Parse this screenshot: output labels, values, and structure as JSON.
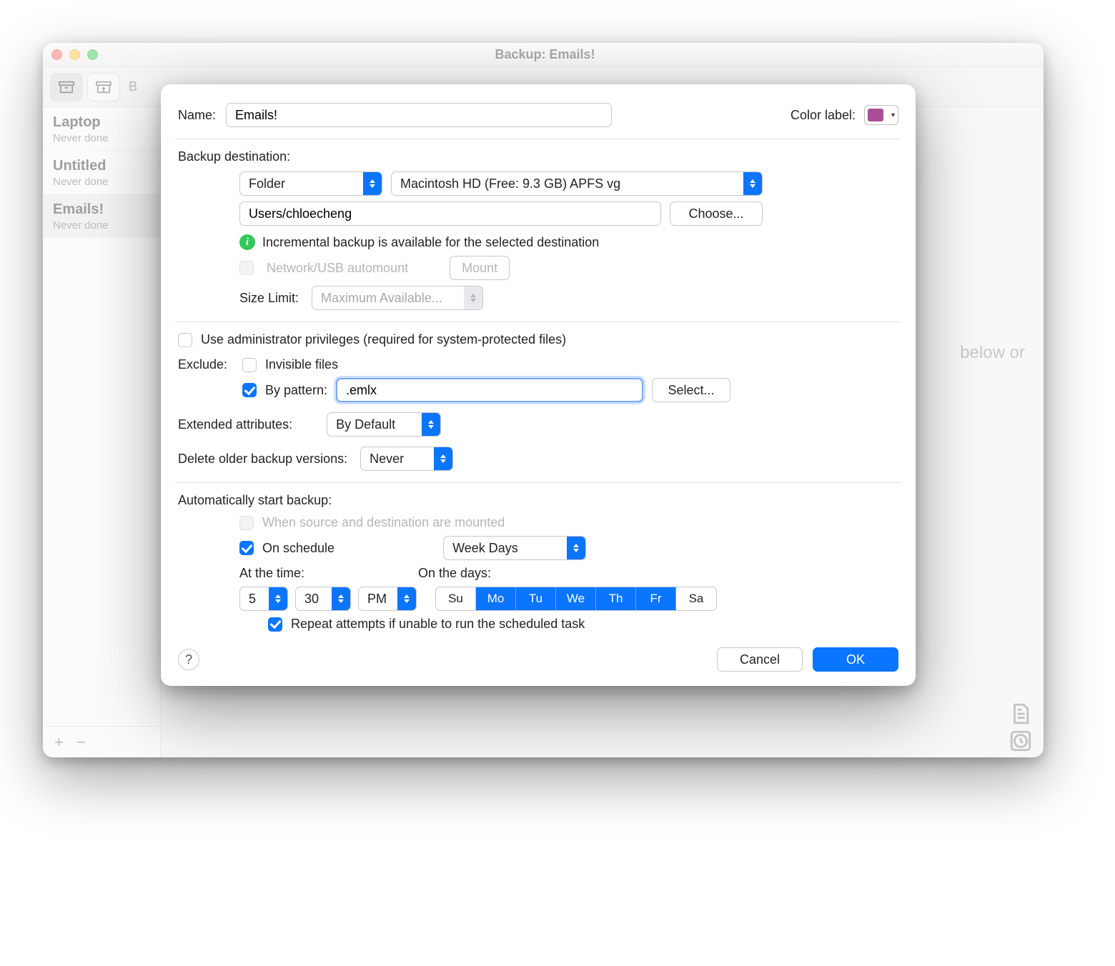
{
  "window": {
    "title": "Backup: Emails!"
  },
  "toolbar": {
    "tab_letter": "B"
  },
  "sidebar": {
    "items": [
      {
        "name": "Laptop",
        "sub": "Never done"
      },
      {
        "name": "Untitled",
        "sub": "Never done"
      },
      {
        "name": "Emails!",
        "sub": "Never done"
      }
    ],
    "add_label": "+",
    "remove_label": "−"
  },
  "bg_hint": "below or",
  "sheet": {
    "name_label": "Name:",
    "name_value": "Emails!",
    "color_label": "Color label:",
    "destination": {
      "header": "Backup destination:",
      "type": "Folder",
      "volume": "Macintosh HD (Free: 9.3 GB) APFS vg",
      "path": "Users/chloecheng",
      "choose": "Choose...",
      "info": "Incremental backup is available for the selected destination",
      "automount": "Network/USB automount",
      "mount": "Mount",
      "size_limit_label": "Size Limit:",
      "size_limit_value": "Maximum Available..."
    },
    "admin_priv": "Use administrator privileges (required for system-protected files)",
    "exclude": {
      "label": "Exclude:",
      "invisible": "Invisible files",
      "by_pattern_label": "By pattern:",
      "pattern_value": ".emlx",
      "select": "Select..."
    },
    "ext_attr": {
      "label": "Extended attributes:",
      "value": "By Default"
    },
    "delete_old": {
      "label": "Delete older backup versions:",
      "value": "Never"
    },
    "auto": {
      "header": "Automatically start backup:",
      "when_mounted": "When source and destination are mounted",
      "on_schedule": "On schedule",
      "schedule_type": "Week Days",
      "at_time_label": "At the time:",
      "hour": "5",
      "minute": "30",
      "ampm": "PM",
      "on_the_days_label": "On the days:",
      "days": [
        "Su",
        "Mo",
        "Tu",
        "We",
        "Th",
        "Fr",
        "Sa"
      ],
      "days_on": [
        false,
        true,
        true,
        true,
        true,
        true,
        false
      ],
      "repeat": "Repeat attempts if unable to run the scheduled task"
    },
    "buttons": {
      "cancel": "Cancel",
      "ok": "OK",
      "help": "?"
    }
  }
}
